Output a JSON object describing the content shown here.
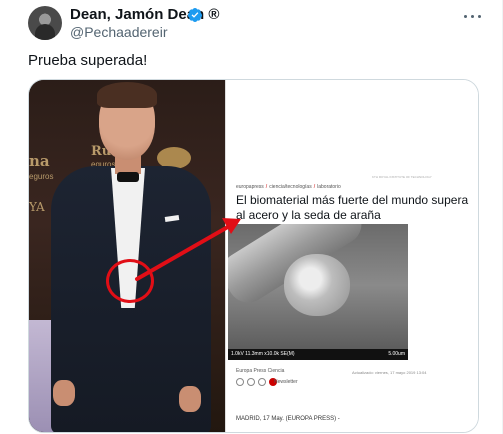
{
  "author": {
    "name": "Dean, Jamón Dean ®",
    "handle": "@Pechaadereir",
    "verified_icon": "verified-badge-icon",
    "verified_color": "#1d9bf0"
  },
  "tweet": {
    "text": "Prueba superada!",
    "more_icon": "more-options-icon"
  },
  "media": {
    "photo": {
      "backdrop_left_1": "na",
      "backdrop_left_2": "eguros",
      "backdrop_left_3": "YA",
      "backdrop_right_1": "Ru",
      "backdrop_right_2": "eguros",
      "annotation_color": "#e10e16"
    },
    "article": {
      "breadcrumb": [
        "europapress",
        "ciencia/tecnologías",
        "laboratorio"
      ],
      "headline": "El biomaterial más fuerte del mundo supera al acero y la seda de araña",
      "sem_bar_text": "1.0kV 11.3mm x10.0k SE(M)",
      "sem_scale_text": "5.00um",
      "caption_credit": "Europa Press Ciencia",
      "newsletter_label": "Newsletter",
      "updated_text": "Actualizado: viernes, 17 mayo 2019 13:04",
      "dateline": "MADRID, 17 May. (EUROPA PRESS) -",
      "photo_credit": "KTH ROYAL INSTITUTE OF TECHNOLOGY"
    }
  }
}
